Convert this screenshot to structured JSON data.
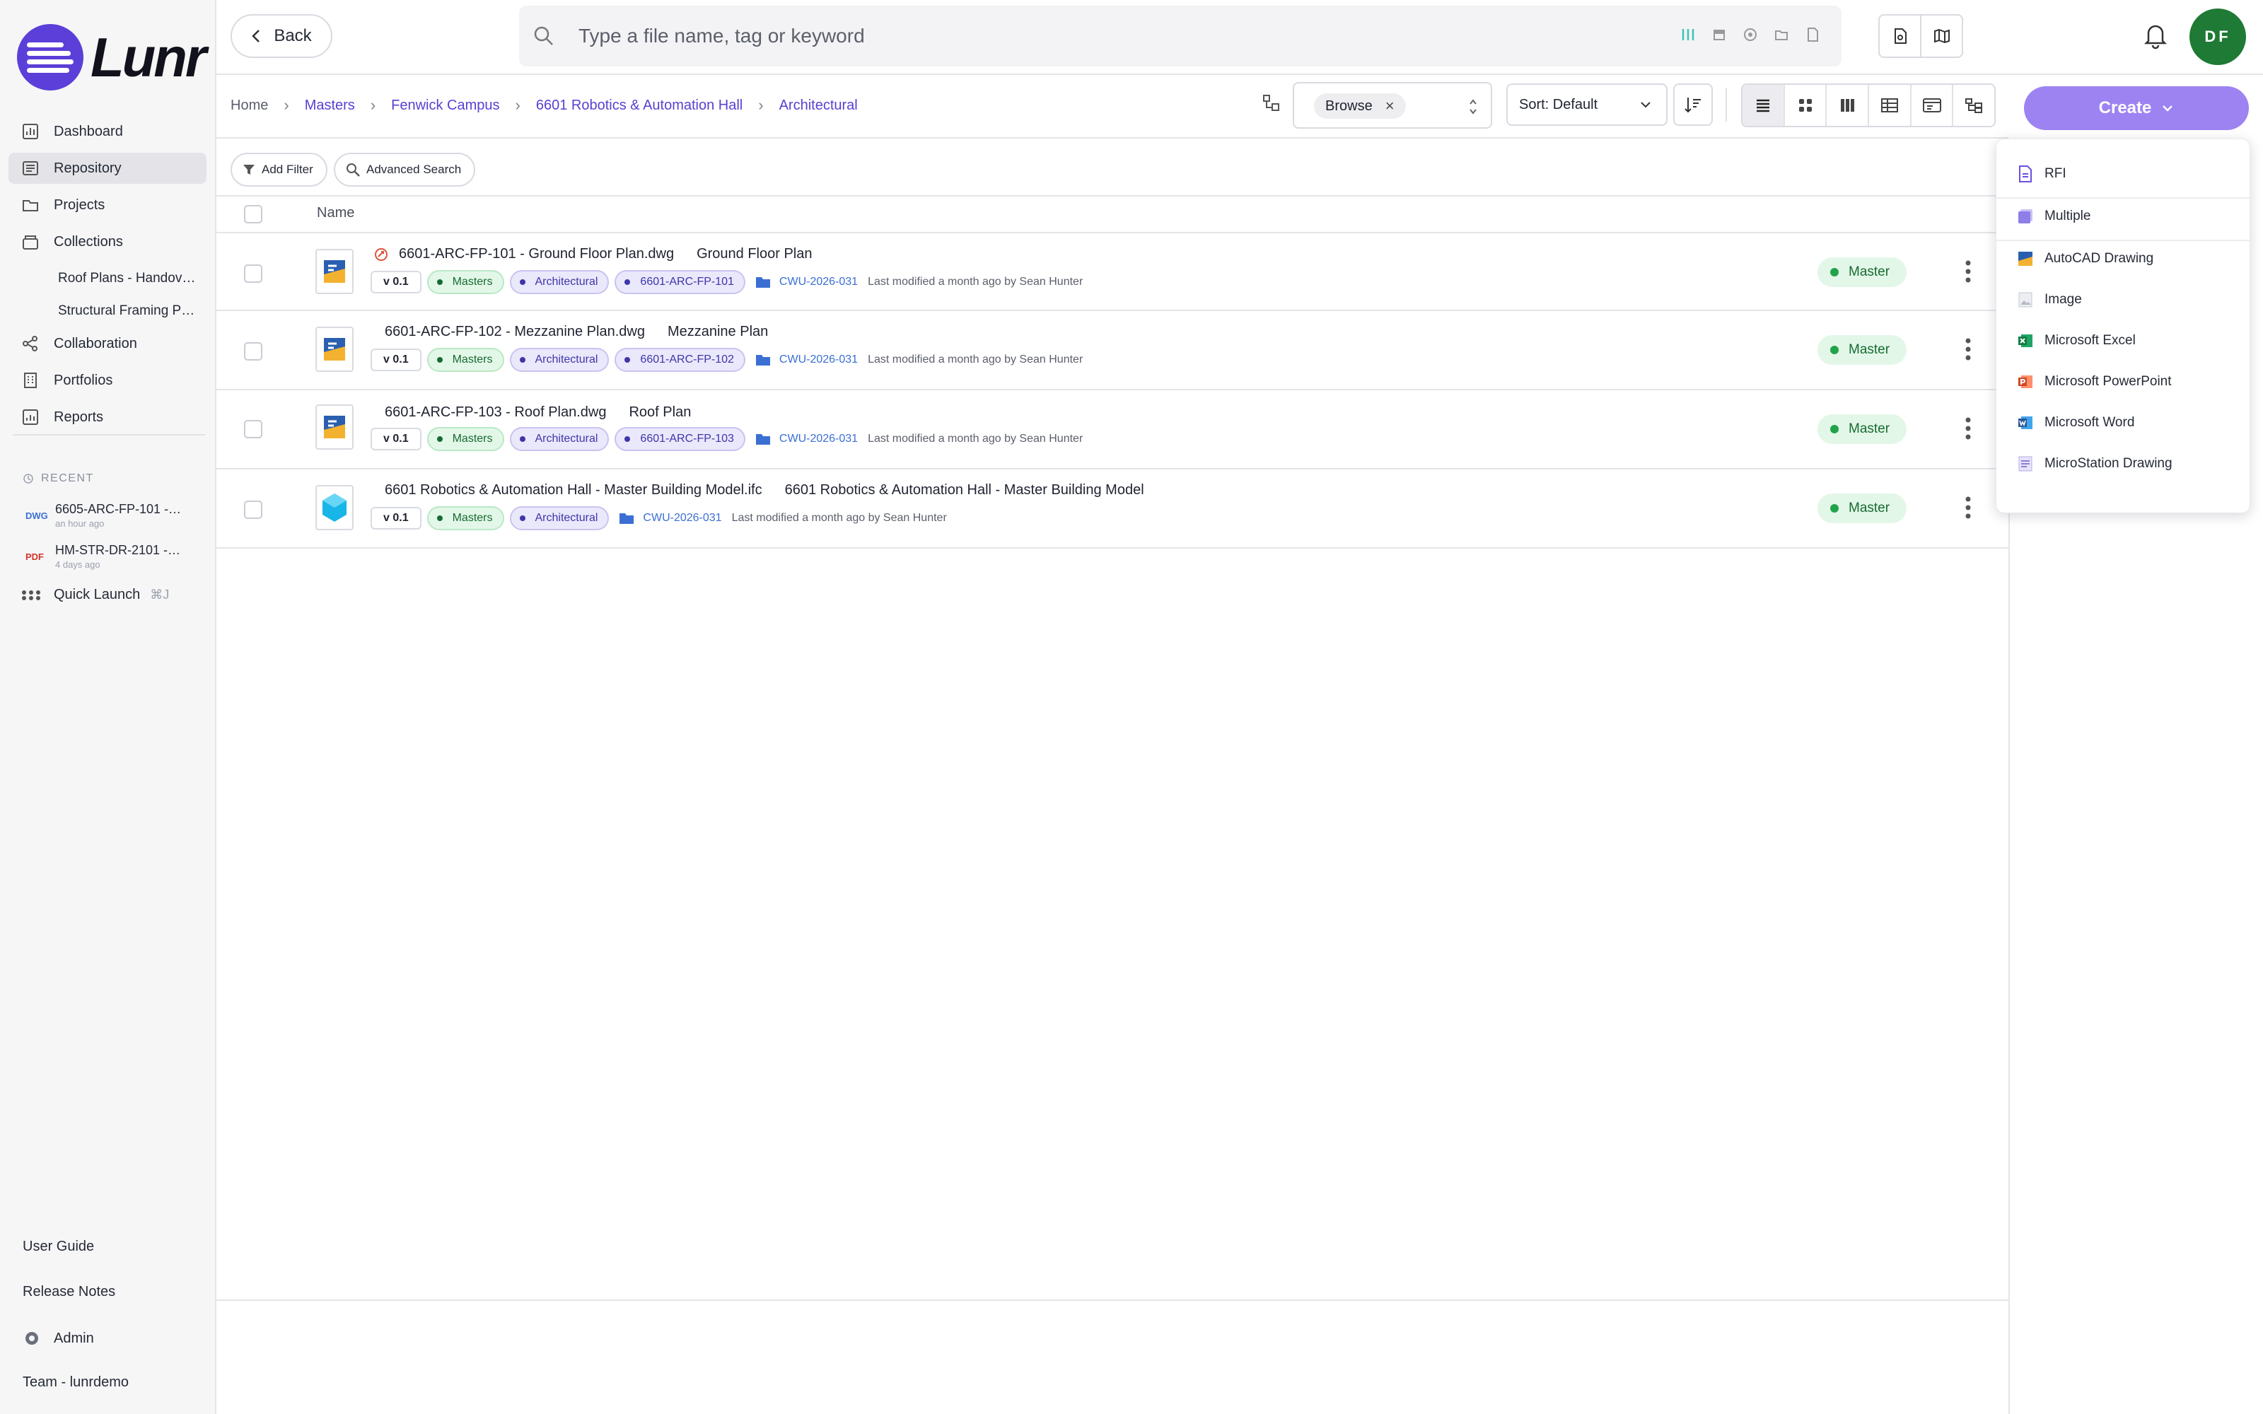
{
  "app": {
    "logo_text": "Lunr",
    "brand_color": "#5b3fd8",
    "accent_color": "#9d83f2"
  },
  "sidebar": {
    "nav": [
      {
        "label": "Dashboard",
        "icon": "chart-icon"
      },
      {
        "label": "Repository",
        "icon": "repository-icon",
        "active": true
      },
      {
        "label": "Projects",
        "icon": "folder-icon"
      },
      {
        "label": "Collections",
        "icon": "collections-icon"
      }
    ],
    "collections": [
      "Roof Plans - Handov…",
      "Structural Framing P…"
    ],
    "nav2": [
      {
        "label": "Collaboration",
        "icon": "share-icon"
      },
      {
        "label": "Portfolios",
        "icon": "building-icon"
      },
      {
        "label": "Reports",
        "icon": "report-icon"
      }
    ],
    "recent_label": "RECENT",
    "recent": [
      {
        "type": "DWG",
        "type_color": "#3b6fd4",
        "name": "6605-ARC-FP-101 -…",
        "time": "an hour ago"
      },
      {
        "type": "PDF",
        "type_color": "#d8342c",
        "name": "HM-STR-DR-2101 -…",
        "time": "4 days ago"
      }
    ],
    "quick_launch": "Quick Launch",
    "quick_launch_kbd": "⌘J",
    "user_guide": "User Guide",
    "release_notes": "Release Notes",
    "admin": "Admin",
    "team": "Team - lunrdemo"
  },
  "header": {
    "back": "Back",
    "search_placeholder": "Type a file name, tag or keyword",
    "avatar_initials": "DF",
    "avatar_color": "#1e7a34"
  },
  "breadcrumb": [
    "Home",
    "Masters",
    "Fenwick Campus",
    "6601 Robotics & Automation Hall",
    "Architectural"
  ],
  "toolbar": {
    "browse_chip": "Browse",
    "sort_label": "Sort: Default",
    "create_label": "Create"
  },
  "filters": {
    "add_filter": "Add Filter",
    "advanced_search": "Advanced Search"
  },
  "table": {
    "name_header": "Name",
    "rows": [
      {
        "filename": "6601-ARC-FP-101 - Ground Floor Plan.dwg",
        "title": "Ground Floor Plan",
        "version": "v 0.1",
        "tags": [
          "Masters",
          "Architectural",
          "6601-ARC-FP-101"
        ],
        "folder": "CWU-2026-031",
        "modified": "Last modified a month ago by Sean Hunter",
        "status": "Master",
        "thumb": "dwg",
        "shared": true
      },
      {
        "filename": "6601-ARC-FP-102 - Mezzanine Plan.dwg",
        "title": "Mezzanine Plan",
        "version": "v 0.1",
        "tags": [
          "Masters",
          "Architectural",
          "6601-ARC-FP-102"
        ],
        "folder": "CWU-2026-031",
        "modified": "Last modified a month ago by Sean Hunter",
        "status": "Master",
        "thumb": "dwg",
        "shared": false
      },
      {
        "filename": "6601-ARC-FP-103 - Roof Plan.dwg",
        "title": "Roof Plan",
        "version": "v 0.1",
        "tags": [
          "Masters",
          "Architectural",
          "6601-ARC-FP-103"
        ],
        "folder": "CWU-2026-031",
        "modified": "Last modified a month ago by Sean Hunter",
        "status": "Master",
        "thumb": "dwg",
        "shared": false
      },
      {
        "filename": "6601 Robotics & Automation Hall - Master Building Model.ifc",
        "title": "6601 Robotics & Automation Hall - Master Building Model",
        "version": "v 0.1",
        "tags": [
          "Masters",
          "Architectural"
        ],
        "folder": "CWU-2026-031",
        "modified": "Last modified a month ago by Sean Hunter",
        "status": "Master",
        "thumb": "ifc",
        "shared": false
      }
    ]
  },
  "create_menu": [
    {
      "label": "RFI",
      "icon": "rfi-icon",
      "color": "#6c4fe0"
    },
    {
      "label": "Multiple",
      "icon": "multiple-icon",
      "color": "#7b69e6"
    },
    {
      "label": "AutoCAD Drawing",
      "icon": "autocad-icon",
      "color": "#2a5fb0"
    },
    {
      "label": "Image",
      "icon": "image-icon",
      "color": "#9aa0ac"
    },
    {
      "label": "Microsoft Excel",
      "icon": "excel-icon",
      "color": "#1d7a45"
    },
    {
      "label": "Microsoft PowerPoint",
      "icon": "powerpoint-icon",
      "color": "#d24726"
    },
    {
      "label": "Microsoft Word",
      "icon": "word-icon",
      "color": "#2b579a"
    },
    {
      "label": "MicroStation Drawing",
      "icon": "microstation-icon",
      "color": "#8d7fd6"
    }
  ]
}
